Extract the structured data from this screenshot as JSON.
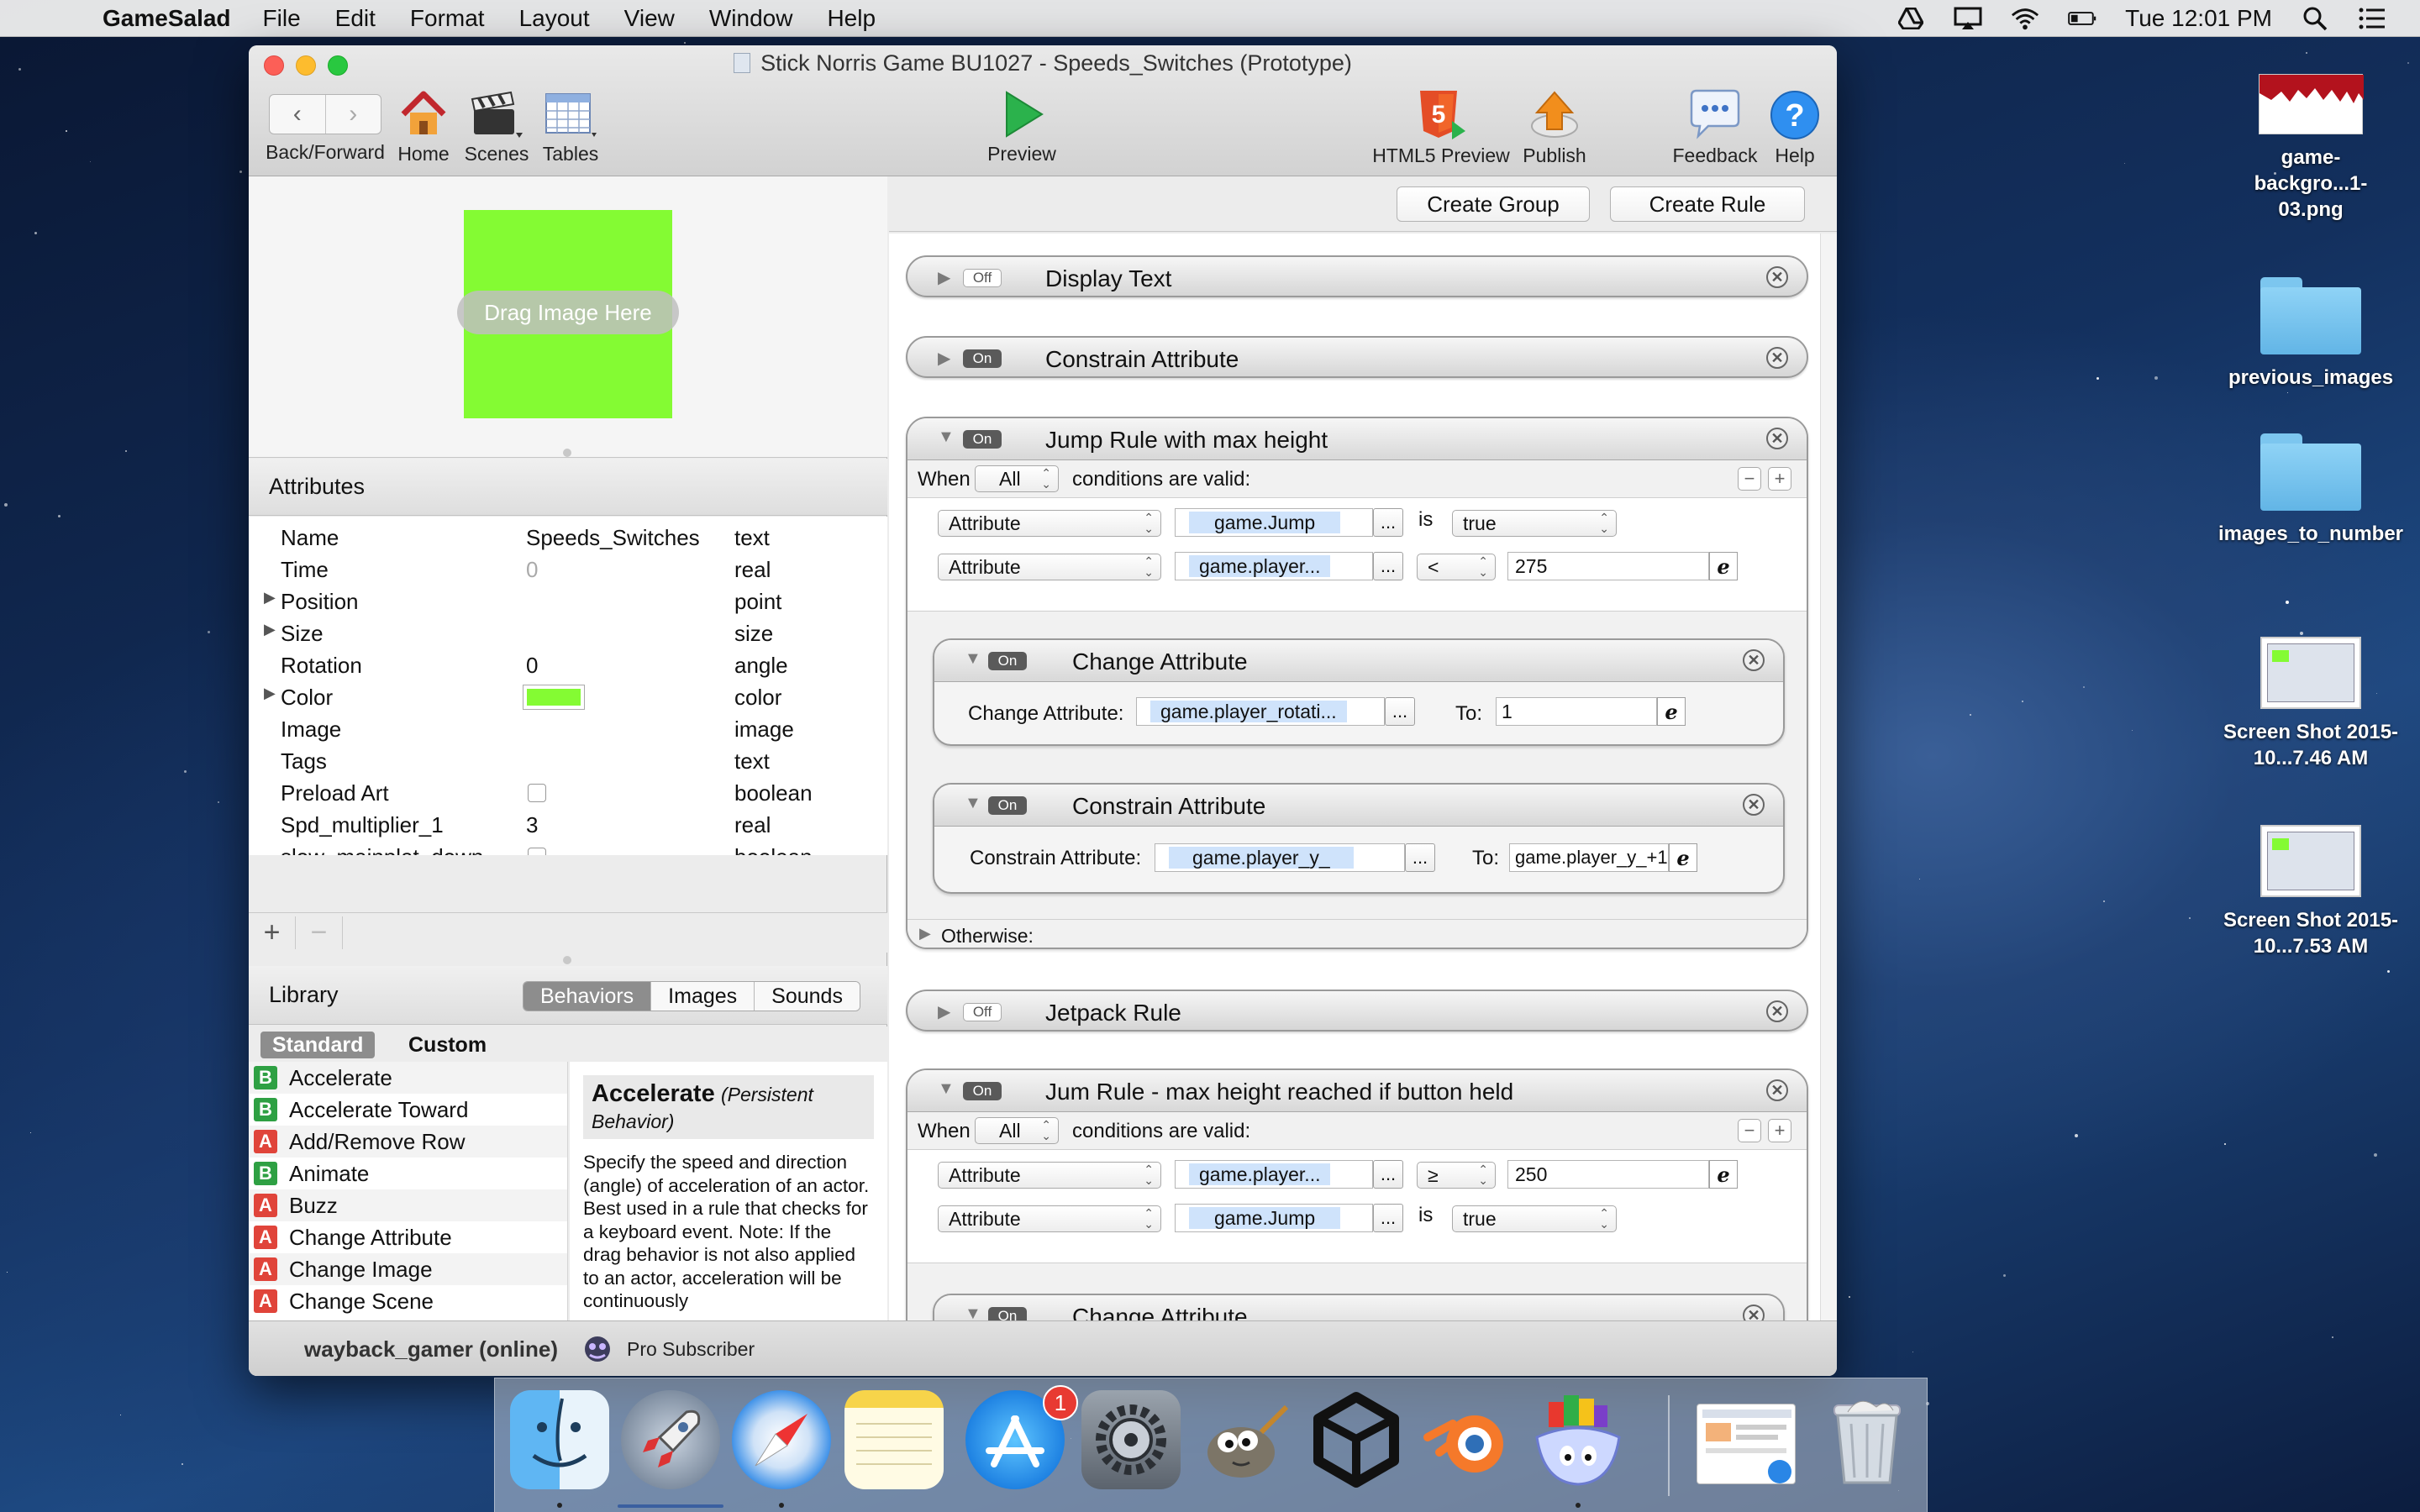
{
  "menubar": {
    "app_name": "GameSalad",
    "menus": [
      "File",
      "Edit",
      "Format",
      "Layout",
      "View",
      "Window",
      "Help"
    ],
    "clock": "Tue 12:01 PM"
  },
  "window": {
    "title": "Stick Norris Game BU1027 - Speeds_Switches (Prototype)",
    "toolbar": {
      "back_forward": "Back/Forward",
      "home": "Home",
      "scenes": "Scenes",
      "tables": "Tables",
      "preview": "Preview",
      "html5_preview": "HTML5 Preview",
      "publish": "Publish",
      "feedback": "Feedback",
      "help": "Help"
    }
  },
  "preview": {
    "drag_label": "Drag Image Here",
    "color": "#84fb33"
  },
  "attributes": {
    "title": "Attributes",
    "rows": [
      {
        "name": "Name",
        "value": "Speeds_Switches",
        "type": "text"
      },
      {
        "name": "Time",
        "value": "0",
        "type": "real"
      },
      {
        "name": "Position",
        "value": "",
        "type": "point"
      },
      {
        "name": "Size",
        "value": "",
        "type": "size"
      },
      {
        "name": "Rotation",
        "value": "0",
        "type": "angle"
      },
      {
        "name": "Color",
        "value": "",
        "type": "color"
      },
      {
        "name": "Image",
        "value": "",
        "type": "image"
      },
      {
        "name": "Tags",
        "value": "",
        "type": "text"
      },
      {
        "name": "Preload Art",
        "value": "",
        "type": "boolean"
      },
      {
        "name": "Spd_multiplier_1",
        "value": "3",
        "type": "real"
      },
      {
        "name": "slow_mainplat_down",
        "value": "",
        "type": "boolean"
      }
    ]
  },
  "library": {
    "title": "Library",
    "tabs": [
      "Behaviors",
      "Images",
      "Sounds"
    ],
    "subtabs": [
      "Standard",
      "Custom"
    ],
    "items": [
      {
        "badge": "B",
        "label": "Accelerate"
      },
      {
        "badge": "B",
        "label": "Accelerate Toward"
      },
      {
        "badge": "A",
        "label": "Add/Remove Row"
      },
      {
        "badge": "B",
        "label": "Animate"
      },
      {
        "badge": "A",
        "label": "Buzz"
      },
      {
        "badge": "A",
        "label": "Change Attribute"
      },
      {
        "badge": "A",
        "label": "Change Image"
      },
      {
        "badge": "A",
        "label": "Change Scene"
      }
    ],
    "desc_title": "Accelerate",
    "desc_sub": "(Persistent Behavior)",
    "desc_text": "Specify the speed and direction (angle) of acceleration of an actor. Best used in a rule that checks for a keyboard event. Note: If the drag behavior is not also applied to an actor, acceleration will be continuously"
  },
  "status": {
    "user": "wayback_gamer (online)",
    "subscription": "Pro Subscriber"
  },
  "rules_panel": {
    "create_group": "Create Group",
    "create_rule": "Create Rule",
    "display_text": {
      "state": "Off",
      "label": "Display Text"
    },
    "constrain_top": {
      "state": "On",
      "label": "Constrain Attribute"
    },
    "jump_rule": {
      "state": "On",
      "label": "Jump Rule with max height",
      "when": "When",
      "all": "All",
      "conditions": "conditions are valid:",
      "cond1": {
        "type": "Attribute",
        "attr": "game.Jump",
        "op": "is",
        "value": "true"
      },
      "cond2": {
        "type": "Attribute",
        "attr": "game.player...",
        "op": "<",
        "value": "275"
      },
      "change": {
        "state": "On",
        "label": "Change Attribute",
        "field_label": "Change Attribute:",
        "attr": "game.player_rotati...",
        "to_label": "To:",
        "to_value": "1"
      },
      "constrain": {
        "state": "On",
        "label": "Constrain Attribute",
        "field_label": "Constrain Attribute:",
        "attr": "game.player_y_",
        "to_label": "To:",
        "to_value": "game.player_y_+1"
      },
      "otherwise": "Otherwise:"
    },
    "jetpack": {
      "state": "Off",
      "label": "Jetpack Rule"
    },
    "jum_rule": {
      "state": "On",
      "label": "Jum Rule -  max height reached if button held",
      "when": "When",
      "all": "All",
      "conditions": "conditions are valid:",
      "cond1": {
        "type": "Attribute",
        "attr": "game.player...",
        "op": "≥",
        "value": "250"
      },
      "cond2": {
        "type": "Attribute",
        "attr": "game.Jump",
        "op": "is",
        "value": "true"
      },
      "change": {
        "state": "On",
        "label": "Change Attribute"
      }
    },
    "dots": "...",
    "e_symbol": "e"
  },
  "desktop_icons": [
    {
      "label": "game-backgro...1-03.png"
    },
    {
      "label": "previous_images"
    },
    {
      "label": "images_to_number"
    },
    {
      "label": "Screen Shot 2015-10...7.46 AM"
    },
    {
      "label": "Screen Shot 2015-10...7.53 AM"
    }
  ],
  "dock": {
    "app_store_badge": "1"
  }
}
